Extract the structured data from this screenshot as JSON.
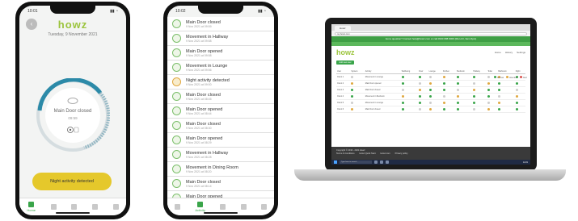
{
  "phone1": {
    "status_time": "10:01",
    "logo": "howz",
    "date": "Tuesday, 9 November 2021",
    "dial_text": "Main Door closed",
    "dial_time": "09:59",
    "alert_button": "Night activity detected",
    "tabs": [
      "Home",
      "",
      "",
      "",
      ""
    ]
  },
  "phone2": {
    "status_time": "10:02",
    "items": [
      {
        "title": "Main Door closed",
        "sub": "9 Nov 2021 at 09:59",
        "warn": false
      },
      {
        "title": "Movement in Hallway",
        "sub": "9 Nov 2021 at 09:58",
        "warn": false
      },
      {
        "title": "Main Door opened",
        "sub": "9 Nov 2021 at 09:58",
        "warn": false
      },
      {
        "title": "Movement in Lounge",
        "sub": "9 Nov 2021 at 09:56",
        "warn": false
      },
      {
        "title": "Night activity detected",
        "sub": "9 Nov 2021 at 09:00",
        "warn": true
      },
      {
        "title": "Main Door closed",
        "sub": "9 Nov 2021 at 08:45",
        "warn": false
      },
      {
        "title": "Main Door opened",
        "sub": "9 Nov 2021 at 08:44",
        "warn": false
      },
      {
        "title": "Main Door closed",
        "sub": "9 Nov 2021 at 08:30",
        "warn": false
      },
      {
        "title": "Main Door opened",
        "sub": "9 Nov 2021 at 08:29",
        "warn": false
      },
      {
        "title": "Movement in Hallway",
        "sub": "9 Nov 2021 at 08:28",
        "warn": false
      },
      {
        "title": "Movement in Dining Room",
        "sub": "9 Nov 2021 at 08:20",
        "warn": false
      },
      {
        "title": "Main Door closed",
        "sub": "9 Nov 2021 at 08:14",
        "warn": false
      },
      {
        "title": "Main Door opened",
        "sub": "9 Nov 2021 at 08:13",
        "warn": false
      }
    ],
    "tabs": [
      "",
      "Activity",
      "",
      "",
      ""
    ]
  },
  "laptop": {
    "tab_title": "Howz",
    "url": "my.howz.com",
    "banner": "Got a question? Contact help@howz.com or call 0330 088 9009 (Mon-Fri, 9am-5pm)",
    "banner2": "",
    "logo": "howz",
    "nav": [
      "Home",
      "History",
      "Settings"
    ],
    "add_button": "Add new user",
    "legend": [
      "Normal",
      "Attention",
      "Alert"
    ],
    "columns": [
      "User",
      "System",
      "Activity",
      "Wellbeing",
      "Door",
      "Lounge",
      "Kitchen",
      "Bedroom",
      "Hallway",
      "Toilet",
      "Bathroom",
      "Night"
    ],
    "rows": [
      [
        "Client 1",
        "",
        "Movement in Lounge",
        "",
        "",
        "",
        "",
        "",
        "",
        "",
        "",
        ""
      ],
      [
        "Client 2",
        "",
        "Main Door opened",
        "",
        "",
        "",
        "",
        "",
        "",
        "",
        "",
        ""
      ],
      [
        "Client 3",
        "",
        "Main Door closed",
        "",
        "",
        "",
        "",
        "",
        "",
        "",
        "",
        ""
      ],
      [
        "Client 4",
        "",
        "Movement in Bedroom",
        "",
        "",
        "",
        "",
        "",
        "",
        "",
        "",
        ""
      ],
      [
        "Client 5",
        "",
        "Movement in Lounge",
        "",
        "",
        "",
        "",
        "",
        "",
        "",
        "",
        ""
      ],
      [
        "Client 6",
        "",
        "Main Door closed",
        "",
        "",
        "",
        "",
        "",
        "",
        "",
        "",
        ""
      ]
    ],
    "footer_line1": "Copyright © 2016 - 2021 Howz",
    "footer_links": [
      "Terms & Conditions",
      "Howz Quick Start",
      "Howz.com",
      "Privacy policy"
    ],
    "footer_line2": "",
    "search_placeholder": "Type here to search",
    "clock": "12:21"
  },
  "colors": {
    "brand_green": "#9bc43c",
    "accent_green": "#3aa54a",
    "alert_yellow": "#e5c82b",
    "dark_footer": "#3a3a3a"
  }
}
